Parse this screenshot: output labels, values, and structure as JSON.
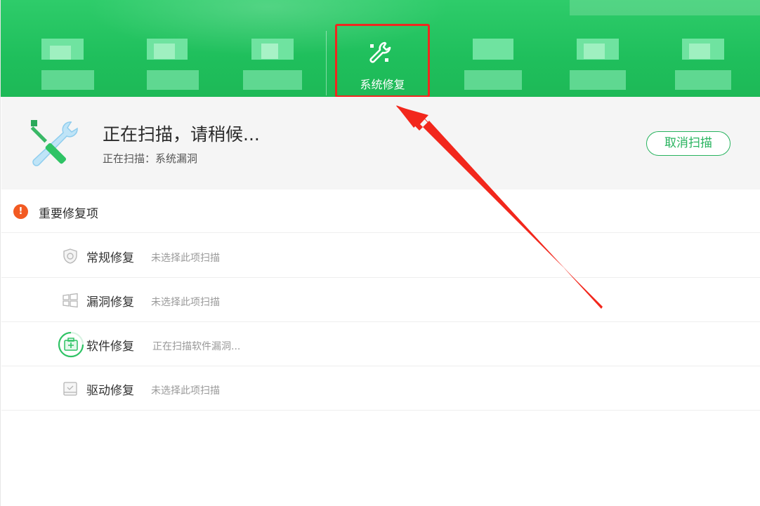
{
  "header": {
    "active_tab": {
      "label": "系统修复",
      "icon": "wrench-icon"
    },
    "colors": {
      "primary": "#1fbf5c",
      "highlight_box": "#f0271f"
    }
  },
  "scan": {
    "title": "正在扫描，请稍候...",
    "subtitle": "正在扫描：系统漏洞",
    "cancel_label": "取消扫描"
  },
  "section": {
    "title": "重要修复项",
    "warning_glyph": "!"
  },
  "items": [
    {
      "label": "常规修复",
      "status": "未选择此项扫描",
      "icon": "shield-icon"
    },
    {
      "label": "漏洞修复",
      "status": "未选择此项扫描",
      "icon": "windows-icon"
    },
    {
      "label": "软件修复",
      "status": "正在扫描软件漏洞...",
      "icon": "software-box-icon"
    },
    {
      "label": "驱动修复",
      "status": "未选择此项扫描",
      "icon": "driver-icon"
    }
  ],
  "annotation": {
    "arrow_color": "#f2271c"
  }
}
